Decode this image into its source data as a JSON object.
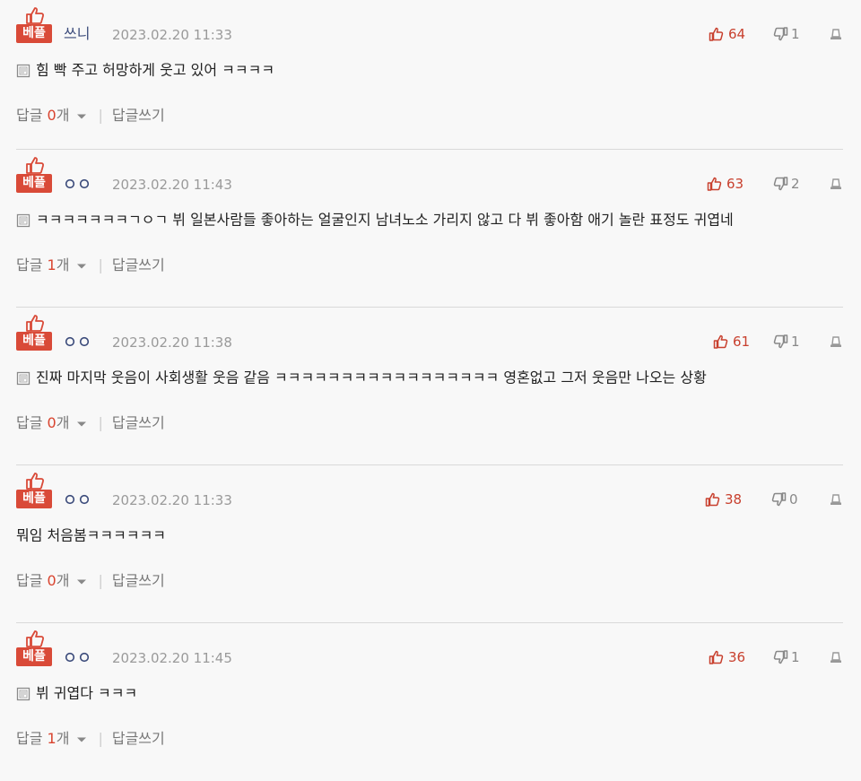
{
  "best_label": "베플",
  "reply_label": "답글",
  "reply_unit": "개",
  "write_reply_label": "답글쓰기",
  "accent_color": "#d94a38",
  "comments": [
    {
      "author": "쓰니",
      "author_display": "text",
      "date": "2023.02.20 11:33",
      "likes": "64",
      "dislikes": "1",
      "has_memo_icon": true,
      "text": "힘 빡 주고 허망하게 웃고 있어 ㅋㅋㅋㅋ",
      "reply_count": "0"
    },
    {
      "author": "ㅇㅇ",
      "author_display": "circles",
      "date": "2023.02.20 11:43",
      "likes": "63",
      "dislikes": "2",
      "has_memo_icon": true,
      "text": "ㅋㅋㅋㅋㅋㅋㅋㄱㅇㄱ 뷔 일본사람들 좋아하는 얼굴인지 남녀노소 가리지 않고 다 뷔 좋아함 애기 놀란 표정도 귀엽네",
      "reply_count": "1"
    },
    {
      "author": "ㅇㅇ",
      "author_display": "circles",
      "date": "2023.02.20 11:38",
      "likes": "61",
      "dislikes": "1",
      "has_memo_icon": true,
      "text": "진짜 마지막 웃음이 사회생활 웃음 같음 ㅋㅋㅋㅋㅋㅋㅋㅋㅋㅋㅋㅋㅋㅋㅋㅋㅋ 영혼없고 그저 웃음만 나오는 상황",
      "reply_count": "0"
    },
    {
      "author": "ㅇㅇ",
      "author_display": "circles",
      "date": "2023.02.20 11:33",
      "likes": "38",
      "dislikes": "0",
      "has_memo_icon": false,
      "text": "뭐임 처음봄ㅋㅋㅋㅋㅋㅋ",
      "reply_count": "0"
    },
    {
      "author": "ㅇㅇ",
      "author_display": "circles",
      "date": "2023.02.20 11:45",
      "likes": "36",
      "dislikes": "1",
      "has_memo_icon": true,
      "text": "뷔 귀엽다 ㅋㅋㅋ",
      "reply_count": "1"
    }
  ]
}
